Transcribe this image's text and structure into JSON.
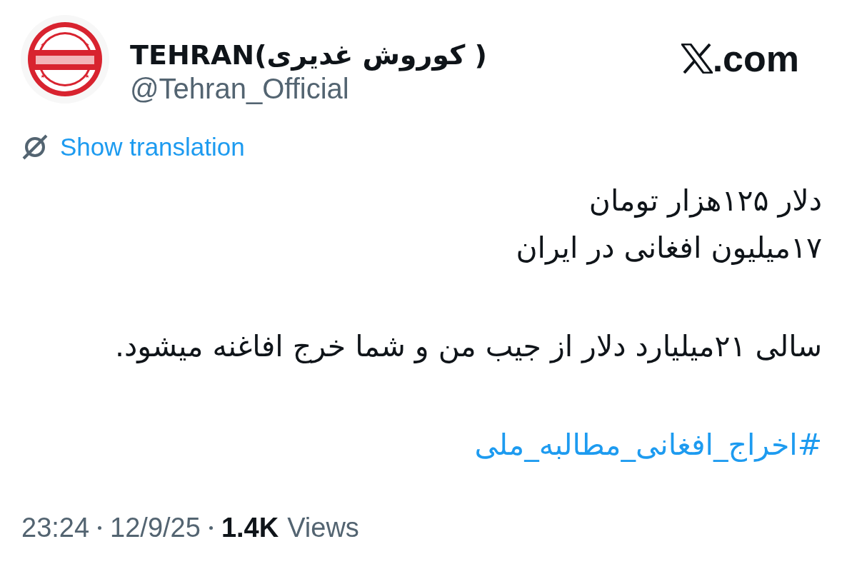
{
  "tweet": {
    "author": {
      "name": "TEHRAN(کوروش غدیری )",
      "handle": "@Tehran_Official"
    },
    "brand": {
      "suffix": ".com"
    },
    "translate_link": "Show translation",
    "paragraphs": [
      {
        "kind": "text",
        "lines": [
          "دلار ۱۲۵هزار تومان",
          "۱۷میلیون افغانی در ایران"
        ]
      },
      {
        "kind": "text",
        "lines": [
          "سالی ۲۱میلیارد دلار از جیب من و شما خرج افاغنه میشود."
        ]
      },
      {
        "kind": "hashtag",
        "lines": [
          "#اخراج_افغانی_مطالبه_ملی"
        ]
      }
    ],
    "time": "23:24",
    "date": "12/9/25",
    "views_count": "1.4K",
    "views_label": "Views"
  }
}
